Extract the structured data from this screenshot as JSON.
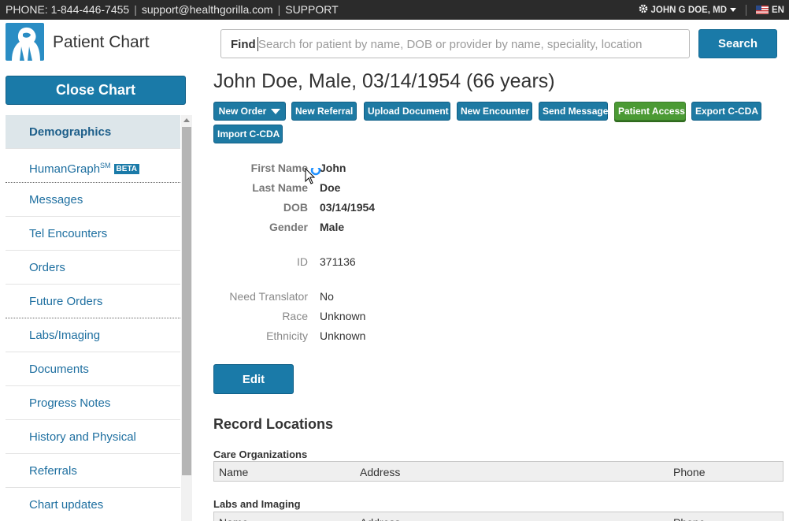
{
  "topbar": {
    "phone": "PHONE: 1-844-446-7455",
    "email": "support@healthgorilla.com",
    "support": "SUPPORT",
    "user": "JOHN G DOE, MD",
    "lang": "EN"
  },
  "header": {
    "app_title": "Patient Chart",
    "find_label": "Find",
    "search_placeholder": "Search for patient by name, DOB or provider by name, speciality, location",
    "search_button": "Search"
  },
  "sidebar": {
    "close_chart": "Close Chart",
    "items": [
      {
        "label": "Demographics"
      },
      {
        "label": "HumanGraph",
        "sup": "SM",
        "badge": "BETA"
      },
      {
        "label": "Messages"
      },
      {
        "label": "Tel Encounters"
      },
      {
        "label": "Orders"
      },
      {
        "label": "Future Orders"
      },
      {
        "label": "Labs/Imaging"
      },
      {
        "label": "Documents"
      },
      {
        "label": "Progress Notes"
      },
      {
        "label": "History and Physical"
      },
      {
        "label": "Referrals"
      },
      {
        "label": "Chart updates"
      }
    ]
  },
  "patient": {
    "title": "John Doe, Male, 03/14/1954 (66 years)"
  },
  "actions": {
    "new_order": "New Order",
    "new_referral": "New Referral",
    "upload_document": "Upload Document",
    "new_encounter": "New Encounter",
    "send_message": "Send Message",
    "patient_access": "Patient Access",
    "export_ccda": "Export C-CDA",
    "import_ccda": "Import C-CDA"
  },
  "demographics": {
    "first_name_label": "First Name",
    "first_name": "John",
    "last_name_label": "Last Name",
    "last_name": "Doe",
    "dob_label": "DOB",
    "dob": "03/14/1954",
    "gender_label": "Gender",
    "gender": "Male",
    "id_label": "ID",
    "id": "371136",
    "translator_label": "Need Translator",
    "translator": "No",
    "race_label": "Race",
    "race": "Unknown",
    "ethnicity_label": "Ethnicity",
    "ethnicity": "Unknown",
    "edit_button": "Edit"
  },
  "record_locations": {
    "title": "Record Locations",
    "care_orgs_title": "Care Organizations",
    "labs_title": "Labs and Imaging",
    "columns": [
      "Name",
      "Address",
      "Phone"
    ]
  }
}
